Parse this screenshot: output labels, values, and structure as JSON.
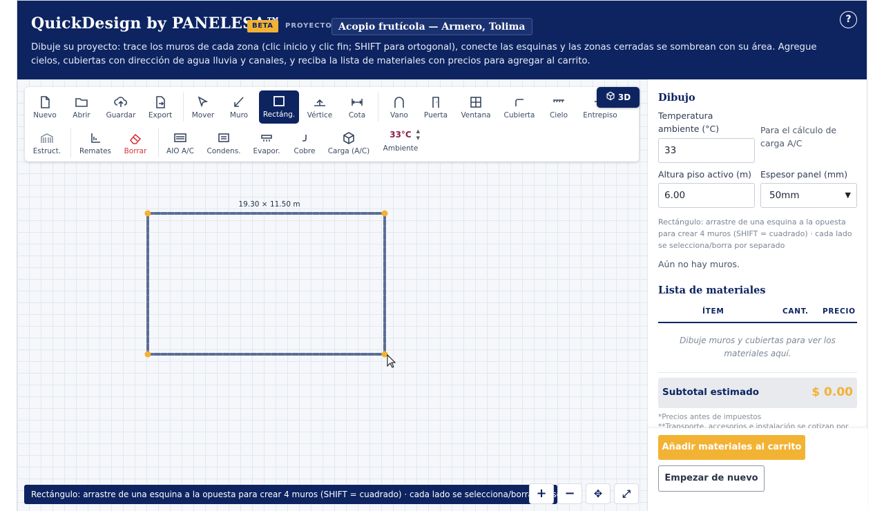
{
  "header": {
    "brand": "QuickDesign by PANELESA™",
    "beta": "BETA",
    "project_label": "PROYECTO",
    "project_name": "Acopio frutícola — Armero, Tolima",
    "help": "?",
    "intro": "Dibuje su proyecto: trace los muros de cada zona (clic inicio y clic fin; SHIFT para ortogonal), conecte las esquinas y las zonas cerradas se sombrean con su área. Agregue cielos, cubiertas con dirección de agua lluvia y canales, y reciba la lista de materiales con precios para agregar al carrito."
  },
  "toolbar": {
    "row1": [
      {
        "label": "Nuevo",
        "icon": "file-icon"
      },
      {
        "label": "Abrir",
        "icon": "folder-icon"
      },
      {
        "label": "Guardar",
        "icon": "cloud-upload-icon"
      },
      {
        "label": "Export",
        "icon": "export-icon"
      },
      {
        "label": "Mover",
        "icon": "cursor-icon"
      },
      {
        "label": "Muro",
        "icon": "wall-line-icon"
      },
      {
        "label": "Rectáng.",
        "icon": "rectangle-icon",
        "active": true
      },
      {
        "label": "Vértice",
        "icon": "vertex-icon"
      },
      {
        "label": "Cota",
        "icon": "dimension-icon"
      },
      {
        "label": "Vano",
        "icon": "opening-icon"
      },
      {
        "label": "Puerta",
        "icon": "door-icon"
      },
      {
        "label": "Ventana",
        "icon": "window-icon"
      },
      {
        "label": "Cubierta",
        "icon": "roof-icon"
      },
      {
        "label": "Cielo",
        "icon": "ceiling-icon"
      },
      {
        "label": "Entrepiso",
        "icon": "mezzanine-icon"
      }
    ],
    "row2": [
      {
        "label": "Estruct.",
        "icon": "structure-icon"
      },
      {
        "label": "Remates",
        "icon": "trim-icon"
      },
      {
        "label": "Borrar",
        "icon": "eraser-icon",
        "danger": true
      },
      {
        "label": "AIO A/C",
        "icon": "aio-ac-icon"
      },
      {
        "label": "Condens.",
        "icon": "condenser-icon"
      },
      {
        "label": "Evapor.",
        "icon": "evaporator-icon"
      },
      {
        "label": "Cobre",
        "icon": "copper-pipe-icon"
      },
      {
        "label": "Carga (A/C)",
        "icon": "cube-icon"
      }
    ],
    "ambient": {
      "value": "33°C",
      "label": "Ambiente"
    },
    "view3d": "3D"
  },
  "canvas": {
    "dimension_label": "19.30 × 11.50 m",
    "status": "Rectángulo: arrastre de una esquina a la opuesta para crear 4 muros (SHIFT = cuadrado) · cada lado se selecciona/borra por separado",
    "zoom_in": "+",
    "zoom_out": "−",
    "pan": "✥",
    "fit": "⤢",
    "colors": {
      "wall": "#5a6d95",
      "corner": "#f2b233"
    }
  },
  "panel": {
    "title": "Dibujo",
    "temp_label": "Temperatura ambiente (°C)",
    "temp_value": "33",
    "temp_hint": "Para el cálculo de carga A/C",
    "height_label": "Altura piso activo (m)",
    "height_value": "6.00",
    "thickness_label": "Espesor panel (mm)",
    "thickness_value": "50mm",
    "hint": "Rectángulo: arrastre de una esquina a la opuesta para crear 4 muros (SHIFT = cuadrado) · cada lado se selecciona/borra por separado",
    "no_walls": "Aún no hay muros.",
    "materials_title": "Lista de materiales",
    "col_item": "ÍTEM",
    "col_qty": "CANT.",
    "col_price": "PRECIO",
    "materials_empty": "Dibuje muros y cubiertas para ver los materiales aquí.",
    "subtotal_label": "Subtotal estimado",
    "subtotal_value": "$ 0.00",
    "note_taxes": "*Precios antes de impuestos",
    "note_transport": "**Transporte, accesorios e instalación se cotizan por",
    "add_cart": "Añadir materiales al carrito",
    "reset": "Empezar de nuevo"
  }
}
